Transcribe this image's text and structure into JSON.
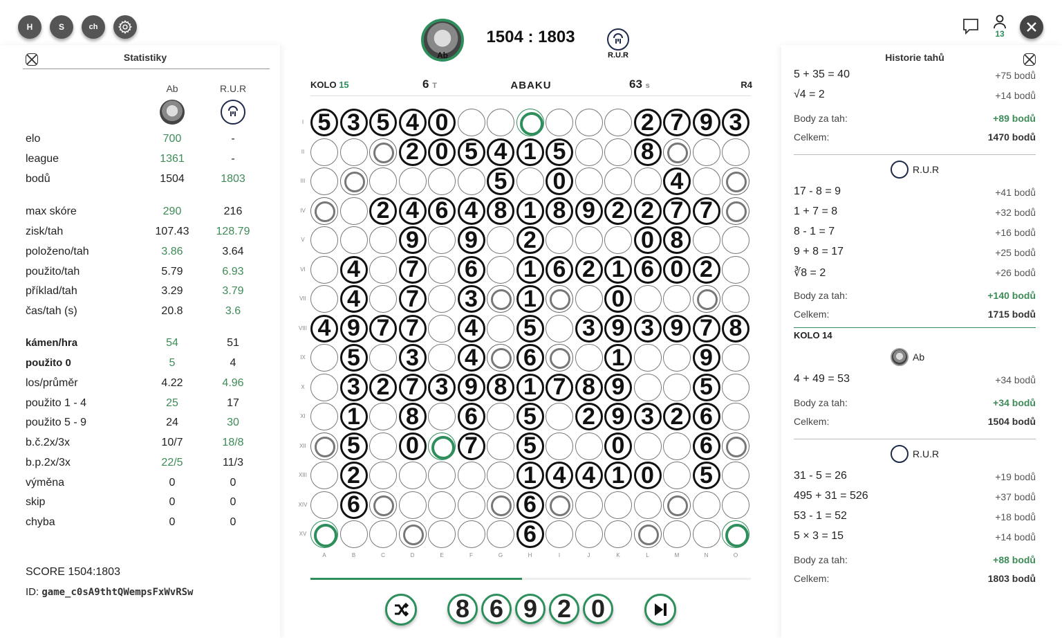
{
  "top_buttons": [
    {
      "label": "H"
    },
    {
      "label": "S"
    },
    {
      "label": "ch"
    }
  ],
  "header": {
    "player1_name": "Ab",
    "player2_name": "R.U.R",
    "score": "1504 : 1803",
    "player_count": "13"
  },
  "bar": {
    "round_label": "KOLO",
    "round": "15",
    "tiles": "6",
    "tiles_unit": "T",
    "logo": "ABAKU",
    "time": "63",
    "time_unit": "s",
    "mode": "R4",
    "progress": 0.48
  },
  "stats": {
    "title": "Statistiky",
    "col1": "Ab",
    "col2": "R.U.R",
    "rows": [
      {
        "label": "elo",
        "v1": "700",
        "v2": "-",
        "g1": true,
        "g2": false,
        "bold": false
      },
      {
        "label": "league",
        "v1": "1361",
        "v2": "-",
        "g1": true,
        "g2": false,
        "bold": false
      },
      {
        "label": "bodů",
        "v1": "1504",
        "v2": "1803",
        "g1": false,
        "g2": true,
        "bold": false
      },
      {
        "label": "max skóre",
        "v1": "290",
        "v2": "216",
        "g1": true,
        "g2": false,
        "bold": false
      },
      {
        "label": "zisk/tah",
        "v1": "107.43",
        "v2": "128.79",
        "g1": false,
        "g2": true,
        "bold": false
      },
      {
        "label": "položeno/tah",
        "v1": "3.86",
        "v2": "3.64",
        "g1": true,
        "g2": false,
        "bold": false
      },
      {
        "label": "použito/tah",
        "v1": "5.79",
        "v2": "6.93",
        "g1": false,
        "g2": true,
        "bold": false
      },
      {
        "label": "příklad/tah",
        "v1": "3.29",
        "v2": "3.79",
        "g1": false,
        "g2": true,
        "bold": false
      },
      {
        "label": "čas/tah (s)",
        "v1": "20.8",
        "v2": "3.6",
        "g1": false,
        "g2": true,
        "bold": false
      },
      {
        "label": "kámen/hra",
        "v1": "54",
        "v2": "51",
        "g1": true,
        "g2": false,
        "bold": true
      },
      {
        "label": "použito 0",
        "v1": "5",
        "v2": "4",
        "g1": true,
        "g2": false,
        "bold": true
      },
      {
        "label": "los/průměr",
        "v1": "4.22",
        "v2": "4.96",
        "g1": false,
        "g2": true,
        "bold": false
      },
      {
        "label": "použito 1 - 4",
        "v1": "25",
        "v2": "17",
        "g1": true,
        "g2": false,
        "bold": false
      },
      {
        "label": "použito 5 - 9",
        "v1": "24",
        "v2": "30",
        "g1": false,
        "g2": true,
        "bold": false
      },
      {
        "label": "b.č.2x/3x",
        "v1": "10/7",
        "v2": "18/8",
        "g1": false,
        "g2": true,
        "bold": false
      },
      {
        "label": "b.p.2x/3x",
        "v1": "22/5",
        "v2": "11/3",
        "g1": true,
        "g2": false,
        "bold": false
      },
      {
        "label": "výměna",
        "v1": "0",
        "v2": "0",
        "g1": false,
        "g2": false,
        "bold": false
      },
      {
        "label": "skip",
        "v1": "0",
        "v2": "0",
        "g1": false,
        "g2": false,
        "bold": false
      },
      {
        "label": "chyba",
        "v1": "0",
        "v2": "0",
        "g1": false,
        "g2": false,
        "bold": false
      }
    ],
    "score": "SCORE 1504:1803",
    "id_label": "ID: ",
    "id_value": "game_c0sA9thtQWempsFxWvRSw"
  },
  "history": {
    "title": "Historie tahů",
    "lines": [
      {
        "t": "eq",
        "text": "5 + 35 = 40",
        "pts": "+75 bodů"
      },
      {
        "t": "eq",
        "text": "√4 = 2",
        "pts": "+14 bodů"
      },
      {
        "t": "sum",
        "label": "Body za tah:",
        "value": "+89 bodů"
      },
      {
        "t": "tot",
        "label": "Celkem:",
        "value": "1470 bodů"
      },
      {
        "t": "sep"
      },
      {
        "t": "player",
        "name": "R.U.R"
      },
      {
        "t": "eq",
        "text": "17 - 8 = 9",
        "pts": "+41 bodů"
      },
      {
        "t": "eq",
        "text": "1 + 7 = 8",
        "pts": "+32 bodů"
      },
      {
        "t": "eq",
        "text": "8 - 1 = 7",
        "pts": "+16 bodů"
      },
      {
        "t": "eq",
        "text": "9 + 8 = 17",
        "pts": "+25 bodů"
      },
      {
        "t": "eq",
        "text": "∛8 = 2",
        "pts": "+26 bodů"
      },
      {
        "t": "sum",
        "label": "Body za tah:",
        "value": "+140 bodů"
      },
      {
        "t": "tot",
        "label": "Celkem:",
        "value": "1715 bodů"
      },
      {
        "t": "round",
        "label": "KOLO 14"
      },
      {
        "t": "player",
        "name": "Ab"
      },
      {
        "t": "eq",
        "text": "4 + 49 = 53",
        "pts": "+34 bodů"
      },
      {
        "t": "sum",
        "label": "Body za tah:",
        "value": "+34 bodů"
      },
      {
        "t": "tot",
        "label": "Celkem:",
        "value": "1504 bodů"
      },
      {
        "t": "sep"
      },
      {
        "t": "player",
        "name": "R.U.R"
      },
      {
        "t": "eq",
        "text": "31 - 5 = 26",
        "pts": "+19 bodů"
      },
      {
        "t": "eq",
        "text": "495 + 31 = 526",
        "pts": "+37 bodů"
      },
      {
        "t": "eq",
        "text": "53 - 1 = 52",
        "pts": "+18 bodů"
      },
      {
        "t": "eq",
        "text": "5 × 3 = 15",
        "pts": "+14 bodů"
      },
      {
        "t": "sum",
        "label": "Body za tah:",
        "value": "+88 bodů"
      },
      {
        "t": "tot",
        "label": "Celkem:",
        "value": "1803 bodů"
      }
    ]
  },
  "board": {
    "row_labels": [
      "I",
      "II",
      "III",
      "IV",
      "V",
      "VI",
      "VII",
      "VIII",
      "IX",
      "X",
      "XI",
      "XII",
      "XIII",
      "XIV",
      "XV"
    ],
    "col_labels": [
      "A",
      "B",
      "C",
      "D",
      "E",
      "F",
      "G",
      "H",
      "I",
      "J",
      "K",
      "L",
      "M",
      "N",
      "O"
    ],
    "rows": [
      "53540..*...2793",
      "..+20541 5..8+..",
      ".+....5.0...4.+.",
      "+.246481892277+",
      "...9.9.2...08...",
      ".4.7.6.16216 02.",
      ".4.7.3+1+.0..+.",
      "4977.4.5.39397 8",
      ".5.3.4+6+.1..9.",
      ".327398178 9..5.",
      ".1.8.6.5.29326.",
      "+5.0*7.5..0..6+",
      ".2.....14410.5.",
      ".6+...+6+...+..",
      "*..+...6...+..*"
    ]
  },
  "rack": [
    "8",
    "6",
    "9",
    "2",
    "0"
  ]
}
